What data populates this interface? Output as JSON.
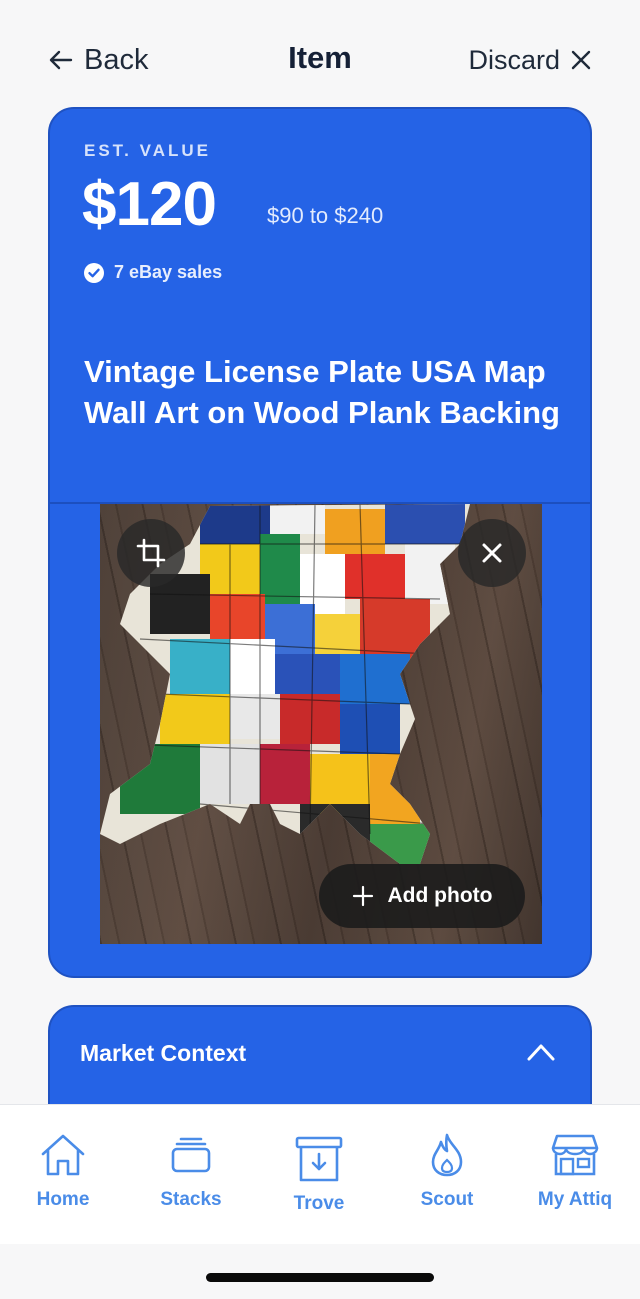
{
  "header": {
    "back_label": "Back",
    "title": "Item",
    "discard_label": "Discard"
  },
  "estimate": {
    "label": "EST. VALUE",
    "value": "$120",
    "range": "$90 to $240",
    "sales": "7 eBay sales"
  },
  "item": {
    "name": "Vintage License Plate USA Map Wall Art on Wood Plank Backing"
  },
  "photo": {
    "add_label": "Add photo"
  },
  "market": {
    "title": "Market Context"
  },
  "tabs": [
    {
      "label": "Home",
      "icon": "home-icon"
    },
    {
      "label": "Stacks",
      "icon": "stacks-icon"
    },
    {
      "label": "Trove",
      "icon": "trove-icon"
    },
    {
      "label": "Scout",
      "icon": "scout-icon"
    },
    {
      "label": "My Attiq",
      "icon": "store-icon"
    }
  ],
  "colors": {
    "accent": "#2563e6",
    "tab_active": "#4a8ce8",
    "background": "#f7f7f8"
  }
}
